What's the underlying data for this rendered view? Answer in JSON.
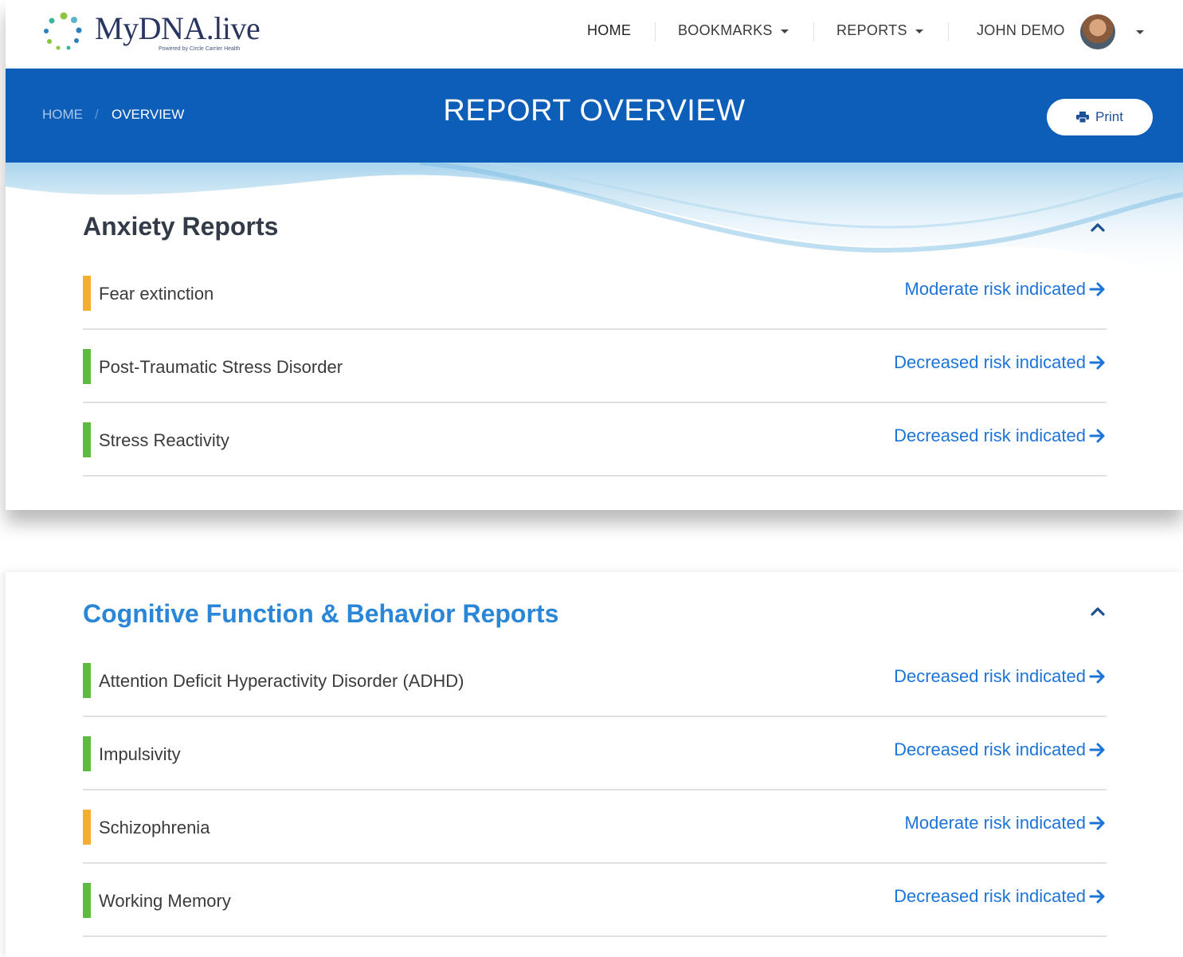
{
  "brand": {
    "name": "MyDNA.live",
    "tagline": "Powered by Circle Carrier Health"
  },
  "nav": {
    "home": "HOME",
    "bookmarks": "BOOKMARKS",
    "reports": "REPORTS",
    "user": "JOHN DEMO"
  },
  "breadcrumb": {
    "home": "HOME",
    "separator": "/",
    "current": "OVERVIEW"
  },
  "page_title": "REPORT OVERVIEW",
  "print_label": "Print",
  "colors": {
    "header_blue": "#0c5eb9",
    "link_blue": "#1d74d8",
    "risk_decreased": "#5dbb3f",
    "risk_moderate": "#f4ae2f"
  },
  "sections": [
    {
      "title": "Anxiety Reports",
      "rows": [
        {
          "label": "Fear extinction",
          "status": "Moderate risk indicated",
          "level": "moderate"
        },
        {
          "label": "Post-Traumatic Stress Disorder",
          "status": "Decreased risk indicated",
          "level": "decreased"
        },
        {
          "label": "Stress Reactivity",
          "status": "Decreased risk indicated",
          "level": "decreased"
        }
      ]
    },
    {
      "title": "Cognitive Function & Behavior Reports",
      "rows": [
        {
          "label": "Attention Deficit Hyperactivity Disorder (ADHD)",
          "status": "Decreased risk indicated",
          "level": "decreased"
        },
        {
          "label": "Impulsivity",
          "status": "Decreased risk indicated",
          "level": "decreased"
        },
        {
          "label": "Schizophrenia",
          "status": "Moderate risk indicated",
          "level": "moderate"
        },
        {
          "label": "Working Memory",
          "status": "Decreased risk indicated",
          "level": "decreased"
        }
      ]
    }
  ]
}
